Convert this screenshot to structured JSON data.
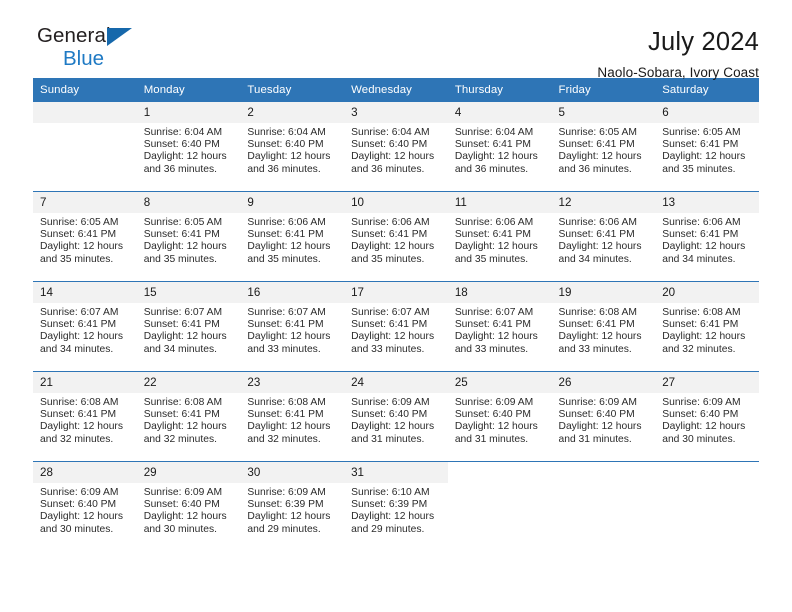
{
  "brand": {
    "name_primary": "General",
    "name_secondary": "Blue"
  },
  "header": {
    "title": "July 2024",
    "subtitle": "Naolo-Sobara, Ivory Coast"
  },
  "colors": {
    "header_row": "#2e75b6",
    "daynum_bg": "#f2f2f2",
    "brand_blue": "#1f7ac4",
    "text": "#1a1a1a"
  },
  "weekdays": [
    "Sunday",
    "Monday",
    "Tuesday",
    "Wednesday",
    "Thursday",
    "Friday",
    "Saturday"
  ],
  "labels": {
    "sunrise_prefix": "Sunrise:",
    "sunset_prefix": "Sunset:",
    "daylight_prefix": "Daylight:"
  },
  "weeks": [
    [
      {
        "day": "",
        "sunrise": "",
        "sunset": "",
        "daylight1": "",
        "daylight2": ""
      },
      {
        "day": "1",
        "sunrise": "Sunrise: 6:04 AM",
        "sunset": "Sunset: 6:40 PM",
        "daylight1": "Daylight: 12 hours",
        "daylight2": "and 36 minutes."
      },
      {
        "day": "2",
        "sunrise": "Sunrise: 6:04 AM",
        "sunset": "Sunset: 6:40 PM",
        "daylight1": "Daylight: 12 hours",
        "daylight2": "and 36 minutes."
      },
      {
        "day": "3",
        "sunrise": "Sunrise: 6:04 AM",
        "sunset": "Sunset: 6:40 PM",
        "daylight1": "Daylight: 12 hours",
        "daylight2": "and 36 minutes."
      },
      {
        "day": "4",
        "sunrise": "Sunrise: 6:04 AM",
        "sunset": "Sunset: 6:41 PM",
        "daylight1": "Daylight: 12 hours",
        "daylight2": "and 36 minutes."
      },
      {
        "day": "5",
        "sunrise": "Sunrise: 6:05 AM",
        "sunset": "Sunset: 6:41 PM",
        "daylight1": "Daylight: 12 hours",
        "daylight2": "and 36 minutes."
      },
      {
        "day": "6",
        "sunrise": "Sunrise: 6:05 AM",
        "sunset": "Sunset: 6:41 PM",
        "daylight1": "Daylight: 12 hours",
        "daylight2": "and 35 minutes."
      }
    ],
    [
      {
        "day": "7",
        "sunrise": "Sunrise: 6:05 AM",
        "sunset": "Sunset: 6:41 PM",
        "daylight1": "Daylight: 12 hours",
        "daylight2": "and 35 minutes."
      },
      {
        "day": "8",
        "sunrise": "Sunrise: 6:05 AM",
        "sunset": "Sunset: 6:41 PM",
        "daylight1": "Daylight: 12 hours",
        "daylight2": "and 35 minutes."
      },
      {
        "day": "9",
        "sunrise": "Sunrise: 6:06 AM",
        "sunset": "Sunset: 6:41 PM",
        "daylight1": "Daylight: 12 hours",
        "daylight2": "and 35 minutes."
      },
      {
        "day": "10",
        "sunrise": "Sunrise: 6:06 AM",
        "sunset": "Sunset: 6:41 PM",
        "daylight1": "Daylight: 12 hours",
        "daylight2": "and 35 minutes."
      },
      {
        "day": "11",
        "sunrise": "Sunrise: 6:06 AM",
        "sunset": "Sunset: 6:41 PM",
        "daylight1": "Daylight: 12 hours",
        "daylight2": "and 35 minutes."
      },
      {
        "day": "12",
        "sunrise": "Sunrise: 6:06 AM",
        "sunset": "Sunset: 6:41 PM",
        "daylight1": "Daylight: 12 hours",
        "daylight2": "and 34 minutes."
      },
      {
        "day": "13",
        "sunrise": "Sunrise: 6:06 AM",
        "sunset": "Sunset: 6:41 PM",
        "daylight1": "Daylight: 12 hours",
        "daylight2": "and 34 minutes."
      }
    ],
    [
      {
        "day": "14",
        "sunrise": "Sunrise: 6:07 AM",
        "sunset": "Sunset: 6:41 PM",
        "daylight1": "Daylight: 12 hours",
        "daylight2": "and 34 minutes."
      },
      {
        "day": "15",
        "sunrise": "Sunrise: 6:07 AM",
        "sunset": "Sunset: 6:41 PM",
        "daylight1": "Daylight: 12 hours",
        "daylight2": "and 34 minutes."
      },
      {
        "day": "16",
        "sunrise": "Sunrise: 6:07 AM",
        "sunset": "Sunset: 6:41 PM",
        "daylight1": "Daylight: 12 hours",
        "daylight2": "and 33 minutes."
      },
      {
        "day": "17",
        "sunrise": "Sunrise: 6:07 AM",
        "sunset": "Sunset: 6:41 PM",
        "daylight1": "Daylight: 12 hours",
        "daylight2": "and 33 minutes."
      },
      {
        "day": "18",
        "sunrise": "Sunrise: 6:07 AM",
        "sunset": "Sunset: 6:41 PM",
        "daylight1": "Daylight: 12 hours",
        "daylight2": "and 33 minutes."
      },
      {
        "day": "19",
        "sunrise": "Sunrise: 6:08 AM",
        "sunset": "Sunset: 6:41 PM",
        "daylight1": "Daylight: 12 hours",
        "daylight2": "and 33 minutes."
      },
      {
        "day": "20",
        "sunrise": "Sunrise: 6:08 AM",
        "sunset": "Sunset: 6:41 PM",
        "daylight1": "Daylight: 12 hours",
        "daylight2": "and 32 minutes."
      }
    ],
    [
      {
        "day": "21",
        "sunrise": "Sunrise: 6:08 AM",
        "sunset": "Sunset: 6:41 PM",
        "daylight1": "Daylight: 12 hours",
        "daylight2": "and 32 minutes."
      },
      {
        "day": "22",
        "sunrise": "Sunrise: 6:08 AM",
        "sunset": "Sunset: 6:41 PM",
        "daylight1": "Daylight: 12 hours",
        "daylight2": "and 32 minutes."
      },
      {
        "day": "23",
        "sunrise": "Sunrise: 6:08 AM",
        "sunset": "Sunset: 6:41 PM",
        "daylight1": "Daylight: 12 hours",
        "daylight2": "and 32 minutes."
      },
      {
        "day": "24",
        "sunrise": "Sunrise: 6:09 AM",
        "sunset": "Sunset: 6:40 PM",
        "daylight1": "Daylight: 12 hours",
        "daylight2": "and 31 minutes."
      },
      {
        "day": "25",
        "sunrise": "Sunrise: 6:09 AM",
        "sunset": "Sunset: 6:40 PM",
        "daylight1": "Daylight: 12 hours",
        "daylight2": "and 31 minutes."
      },
      {
        "day": "26",
        "sunrise": "Sunrise: 6:09 AM",
        "sunset": "Sunset: 6:40 PM",
        "daylight1": "Daylight: 12 hours",
        "daylight2": "and 31 minutes."
      },
      {
        "day": "27",
        "sunrise": "Sunrise: 6:09 AM",
        "sunset": "Sunset: 6:40 PM",
        "daylight1": "Daylight: 12 hours",
        "daylight2": "and 30 minutes."
      }
    ],
    [
      {
        "day": "28",
        "sunrise": "Sunrise: 6:09 AM",
        "sunset": "Sunset: 6:40 PM",
        "daylight1": "Daylight: 12 hours",
        "daylight2": "and 30 minutes."
      },
      {
        "day": "29",
        "sunrise": "Sunrise: 6:09 AM",
        "sunset": "Sunset: 6:40 PM",
        "daylight1": "Daylight: 12 hours",
        "daylight2": "and 30 minutes."
      },
      {
        "day": "30",
        "sunrise": "Sunrise: 6:09 AM",
        "sunset": "Sunset: 6:39 PM",
        "daylight1": "Daylight: 12 hours",
        "daylight2": "and 29 minutes."
      },
      {
        "day": "31",
        "sunrise": "Sunrise: 6:10 AM",
        "sunset": "Sunset: 6:39 PM",
        "daylight1": "Daylight: 12 hours",
        "daylight2": "and 29 minutes."
      },
      {
        "day": "",
        "sunrise": "",
        "sunset": "",
        "daylight1": "",
        "daylight2": ""
      },
      {
        "day": "",
        "sunrise": "",
        "sunset": "",
        "daylight1": "",
        "daylight2": ""
      },
      {
        "day": "",
        "sunrise": "",
        "sunset": "",
        "daylight1": "",
        "daylight2": ""
      }
    ]
  ]
}
